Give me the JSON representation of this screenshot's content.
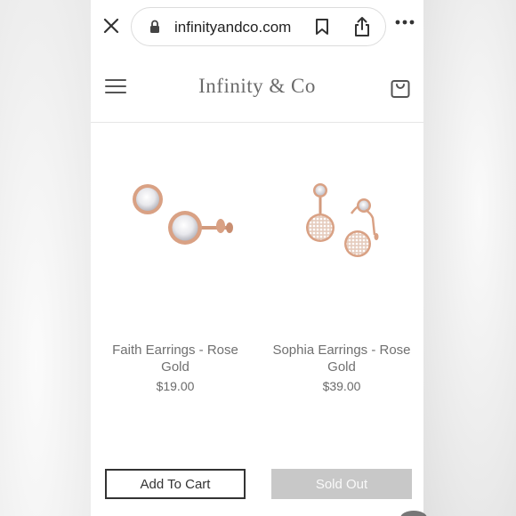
{
  "browser": {
    "url": "infinityandco.com"
  },
  "site": {
    "brand": "Infinity & Co"
  },
  "products": [
    {
      "name": "Faith Earrings - Rose Gold",
      "price": "$19.00",
      "button": "Add To Cart"
    },
    {
      "name": "Sophia Earrings - Rose Gold",
      "price": "$39.00",
      "button": "Sold Out"
    }
  ],
  "colors": {
    "rose_gold": "#d9a184",
    "sold_out_bg": "#c8c8c8",
    "brand_text": "#6b6b6b"
  },
  "icons": [
    "close-icon",
    "lock-icon",
    "bookmark-icon",
    "share-icon",
    "more-icon",
    "menu-icon",
    "cart-icon"
  ]
}
